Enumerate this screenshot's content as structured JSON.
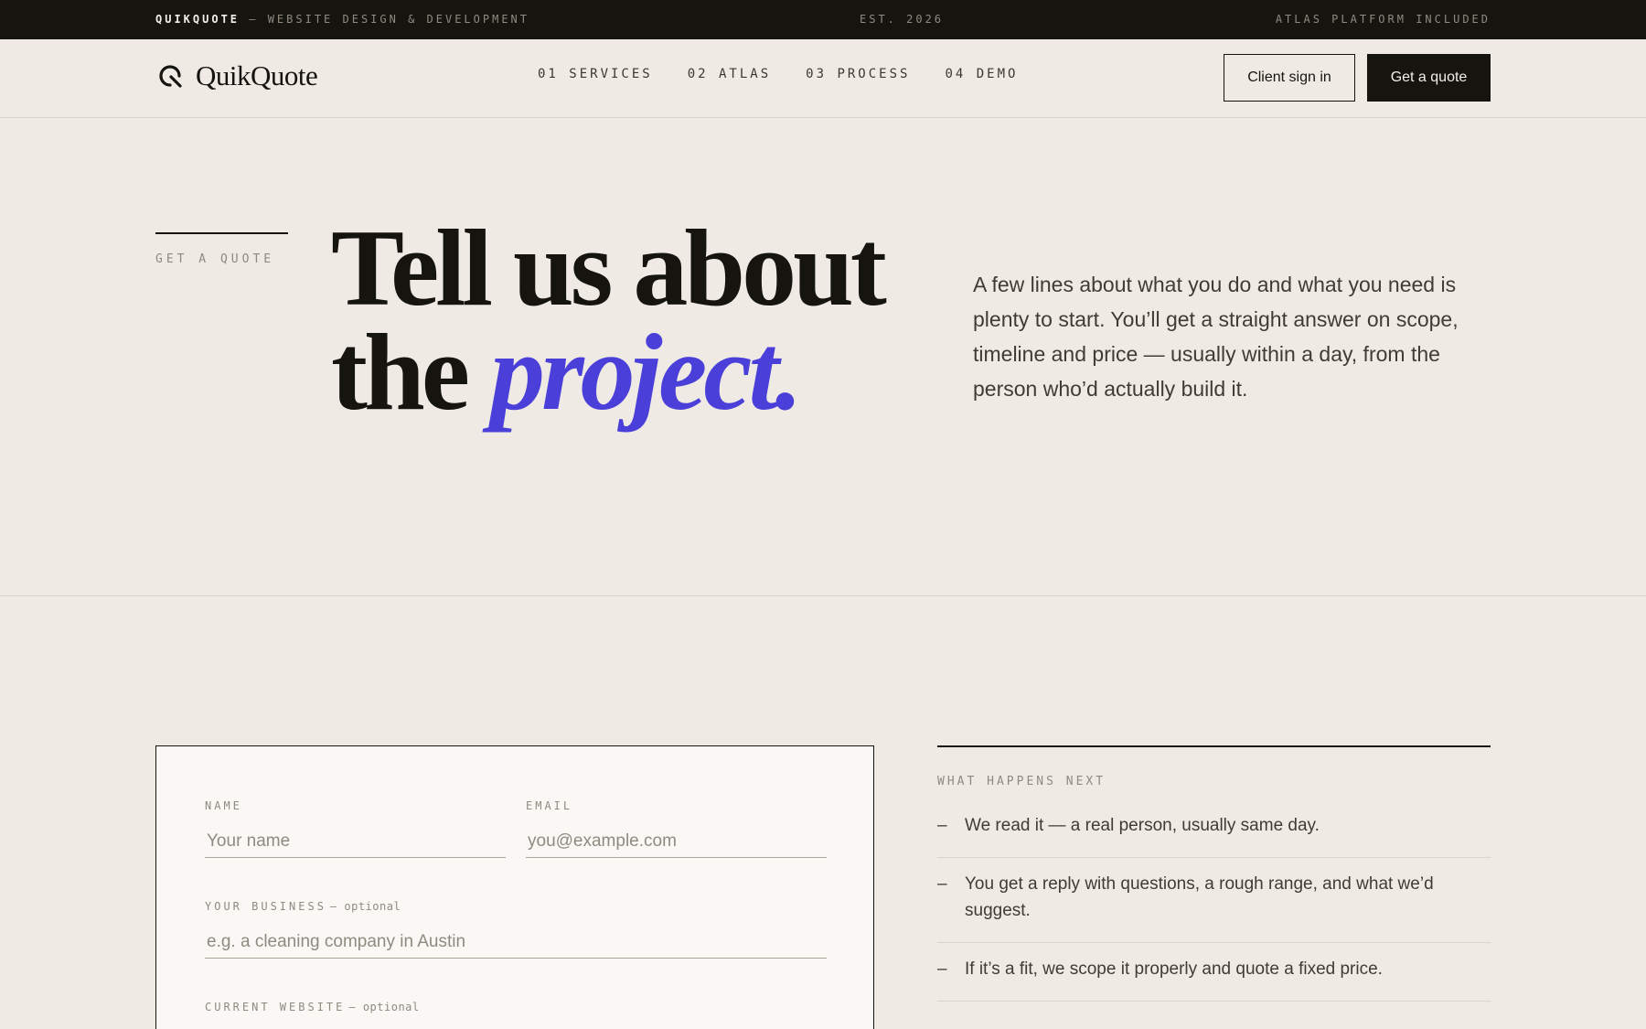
{
  "topbar": {
    "brand": "QUIKQUOTE",
    "tagline": " — WEBSITE DESIGN & DEVELOPMENT",
    "established": "EST. 2026",
    "platform_note": "ATLAS PLATFORM INCLUDED"
  },
  "header": {
    "logo_text": "QuikQuote",
    "nav": [
      {
        "label": "01 SERVICES"
      },
      {
        "label": "02 ATLAS"
      },
      {
        "label": "03 PROCESS"
      },
      {
        "label": "04 DEMO"
      }
    ],
    "sign_in_label": "Client sign in",
    "quote_label": "Get a quote"
  },
  "hero": {
    "kicker": "GET A QUOTE",
    "title_line1": "Tell us about",
    "title_line2_plain": "the ",
    "title_line2_accent": "project.",
    "description": "A few lines about what you do and what you need is plenty to start. You’ll get a straight answer on scope, timeline and price — usually within a day, from the person who’d actually build it."
  },
  "form": {
    "name_label": "NAME",
    "name_placeholder": "Your name",
    "email_label": "EMAIL",
    "email_placeholder": "you@example.com",
    "business_label": "YOUR BUSINESS",
    "business_optional": "— optional",
    "business_placeholder": "e.g. a cleaning company in Austin",
    "website_label": "CURRENT WEBSITE",
    "website_optional": "— optional"
  },
  "next_steps": {
    "title": "WHAT HAPPENS NEXT",
    "items": [
      {
        "dash": "–",
        "text": "We read it — a real person, usually same day."
      },
      {
        "dash": "–",
        "text": "You get a reply with questions, a rough range, and what we’d suggest."
      },
      {
        "dash": "–",
        "text": "If it’s a fit, we scope it properly and quote a fixed price."
      }
    ]
  },
  "colors": {
    "background": "#efebe4",
    "ink": "#16140f",
    "accent": "#4a3fd9",
    "muted": "#8f8a80"
  }
}
